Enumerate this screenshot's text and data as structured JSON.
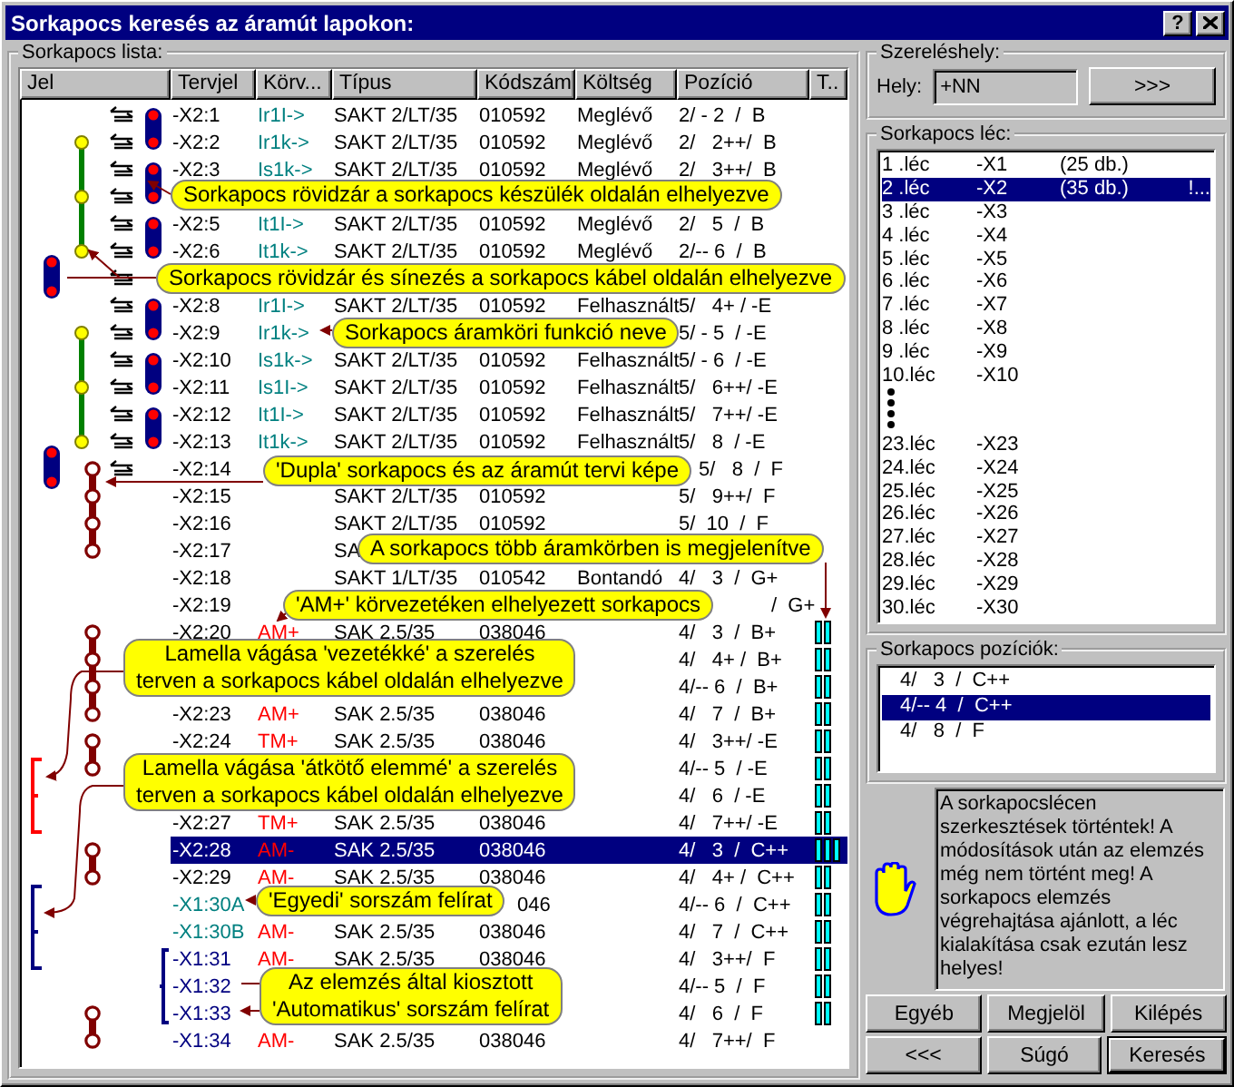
{
  "window": {
    "title": "Sorkapocs keresés az áramút lapokon:",
    "help_button": "?"
  },
  "terminal_list": {
    "title": "Sorkapocs lista:",
    "columns": [
      "Jel",
      "Tervjel",
      "Körv...",
      "Típus",
      "Kódszám",
      "Költség",
      "Pozíció",
      "T.."
    ],
    "rows": [
      {
        "kind": "plain",
        "tervjel": "-X2:1",
        "korv": "Ir1I->",
        "color": "#008080",
        "tipus": "SAKT 2/LT/35",
        "kodszam": "010592",
        "koltseg": "Meglévő",
        "pozicio": "2/ - 2  /  B",
        "selected": false
      },
      {
        "kind": "plain",
        "tervjel": "-X2:2",
        "korv": "Ir1k->",
        "color": "#008080",
        "tipus": "SAKT 2/LT/35",
        "kodszam": "010592",
        "koltseg": "Meglévő",
        "pozicio": "2/   2++/  B",
        "selected": false
      },
      {
        "kind": "plain",
        "tervjel": "-X2:3",
        "korv": "Is1k->",
        "color": "#008080",
        "tipus": "SAKT 2/LT/35",
        "kodszam": "010592",
        "koltseg": "Meglévő",
        "pozicio": "2/   3++/  B",
        "selected": false
      },
      {
        "kind": "hidden"
      },
      {
        "kind": "plain",
        "tervjel": "-X2:5",
        "korv": "It1I->",
        "color": "#008080",
        "tipus": "SAKT 2/LT/35",
        "kodszam": "010592",
        "koltseg": "Meglévő",
        "pozicio": "2/   5  /  B",
        "selected": false
      },
      {
        "kind": "plain",
        "tervjel": "-X2:6",
        "korv": "It1k->",
        "color": "#008080",
        "tipus": "SAKT 2/LT/35",
        "kodszam": "010592",
        "koltseg": "Meglévő",
        "pozicio": "2/-- 6  /  B",
        "selected": false
      },
      {
        "kind": "hidden"
      },
      {
        "kind": "plain",
        "tervjel": "-X2:8",
        "korv": "Ir1I->",
        "color": "#008080",
        "tipus": "SAKT 2/LT/35",
        "kodszam": "010592",
        "koltseg": "Felhasznált",
        "pozicio": "5/   4+ / -E",
        "selected": false
      },
      {
        "kind": "plain",
        "tervjel": "-X2:9",
        "korv": "Ir1k->",
        "color": "#008080",
        "pozicio": "5/ - 5  / -E",
        "selected": false
      },
      {
        "kind": "plain",
        "tervjel": "-X2:10",
        "korv": "Is1k->",
        "color": "#008080",
        "tipus": "SAKT 2/LT/35",
        "kodszam": "010592",
        "koltseg": "Felhasznált",
        "pozicio": "5/ - 6  / -E",
        "selected": false
      },
      {
        "kind": "plain",
        "tervjel": "-X2:11",
        "korv": "Is1I->",
        "color": "#008080",
        "tipus": "SAKT 2/LT/35",
        "kodszam": "010592",
        "koltseg": "Felhasznált",
        "pozicio": "5/   6++/ -E",
        "selected": false
      },
      {
        "kind": "plain",
        "tervjel": "-X2:12",
        "korv": "It1I->",
        "color": "#008080",
        "tipus": "SAKT 2/LT/35",
        "kodszam": "010592",
        "koltseg": "Felhasznált",
        "pozicio": "5/   7++/ -E",
        "selected": false
      },
      {
        "kind": "plain",
        "tervjel": "-X2:13",
        "korv": "It1k->",
        "color": "#008080",
        "tipus": "SAKT 2/LT/35",
        "kodszam": "010592",
        "koltseg": "Felhasznált",
        "pozicio": "5/   8  / -E",
        "selected": false
      },
      {
        "kind": "plain",
        "tervjel": "-X2:14",
        "pozicio": "5/   8  /  F",
        "selected": false
      },
      {
        "kind": "plain",
        "tervjel": "-X2:15",
        "tipus": "SAKT 2/LT/35",
        "kodszam": "010592",
        "pozicio": "5/   9++/  F",
        "selected": false
      },
      {
        "kind": "plain",
        "tervjel": "-X2:16",
        "tipus": "SAKT 2/LT/35",
        "kodszam": "010592",
        "pozicio": "5/  10  /  F",
        "selected": false
      },
      {
        "kind": "plain",
        "tervjel": "-X2:17",
        "tipus": "SA",
        "selected": false
      },
      {
        "kind": "plain",
        "tervjel": "-X2:18",
        "tipus": "SAKT 1/LT/35",
        "kodszam": "010542",
        "koltseg": "Bontandó",
        "pozicio": "4/   3  /  G+",
        "selected": false
      },
      {
        "kind": "plain",
        "tervjel": "-X2:19",
        "pozicio": "/  G+",
        "selected": false
      },
      {
        "kind": "plain",
        "tervjel": "-X2:20",
        "korv": "AM+",
        "color": "#ff0000",
        "tipus": "SAK 2.5/35",
        "kodszam": "038046",
        "pozicio": "4/   3  /  B+",
        "t_cell": {
          "kind": "double"
        },
        "selected": false
      },
      {
        "kind": "plain",
        "pozicio": "4/   4+ /  B+",
        "t_cell": {
          "kind": "double"
        },
        "selected": false
      },
      {
        "kind": "plain",
        "pozicio": "4/-- 6  /  B+",
        "t_cell": {
          "kind": "double"
        },
        "selected": false
      },
      {
        "kind": "plain",
        "tervjel": "-X2:23",
        "korv": "AM+",
        "color": "#ff0000",
        "tipus": "SAK 2.5/35",
        "kodszam": "038046",
        "pozicio": "4/   7  /  B+",
        "t_cell": {
          "kind": "double"
        },
        "selected": false
      },
      {
        "kind": "plain",
        "tervjel": "-X2:24",
        "korv": "TM+",
        "color": "#ff0000",
        "tipus": "SAK 2.5/35",
        "kodszam": "038046",
        "pozicio": "4/   3++/ -E",
        "t_cell": {
          "kind": "double"
        },
        "selected": false
      },
      {
        "kind": "plain",
        "pozicio": "4/-- 5  / -E",
        "t_cell": {
          "kind": "double"
        },
        "selected": false
      },
      {
        "kind": "plain",
        "pozicio": "4/   6  / -E",
        "t_cell": {
          "kind": "double"
        },
        "selected": false
      },
      {
        "kind": "plain",
        "tervjel": "-X2:27",
        "korv": "TM+",
        "color": "#ff0000",
        "tipus": "SAK 2.5/35",
        "kodszam": "038046",
        "pozicio": "4/   7++/ -E",
        "t_cell": {
          "kind": "double"
        },
        "selected": false
      },
      {
        "kind": "plain",
        "tervjel": "-X2:28",
        "korv": "AM-",
        "color": "#ff0000",
        "tipus": "SAK 2.5/35",
        "kodszam": "038046",
        "pozicio": "4/   3  /  C++",
        "t_cell": {
          "kind": "triple"
        },
        "selected": true
      },
      {
        "kind": "plain",
        "tervjel": "-X2:29",
        "korv": "AM-",
        "color": "#ff0000",
        "tipus": "SAK 2.5/35",
        "kodszam": "038046",
        "pozicio": "4/   4+ /  C++",
        "t_cell": {
          "kind": "double"
        },
        "selected": false
      },
      {
        "kind": "individual",
        "tervjel": "-X1:30A",
        "kodszam": "046",
        "pozicio": "4/-- 6  /  C++",
        "t_cell": {
          "kind": "double"
        },
        "selected": false
      },
      {
        "kind": "individual",
        "tervjel": "-X1:30B",
        "korv": "AM-",
        "color": "#ff0000",
        "tipus": "SAK 2.5/35",
        "kodszam": "038046",
        "pozicio": "4/   7  /  C++",
        "t_cell": {
          "kind": "double"
        },
        "selected": false
      },
      {
        "kind": "automatic",
        "tervjel": "-X1:31",
        "korv": "AM-",
        "color": "#ff0000",
        "tipus": "SAK 2.5/35",
        "kodszam": "038046",
        "pozicio": "4/   3++/  F",
        "t_cell": {
          "kind": "double"
        },
        "selected": false
      },
      {
        "kind": "automatic",
        "tervjel": "-X1:32",
        "pozicio": "4/-- 5  /  F",
        "t_cell": {
          "kind": "double"
        },
        "selected": false
      },
      {
        "kind": "automatic",
        "tervjel": "-X1:33",
        "pozicio": "4/   6  /  F",
        "t_cell": {
          "kind": "double"
        },
        "selected": false
      },
      {
        "kind": "automatic",
        "tervjel": "-X1:34",
        "korv": "AM-",
        "color": "#ff0000",
        "tipus": "SAK 2.5/35",
        "kodszam": "038046",
        "pozicio": "4/   7++/  F",
        "selected": false
      }
    ],
    "callouts": [
      {
        "lines": [
          "Sorkapocs rövidzár a sorkapocs készülék oldalán elhelyezve"
        ]
      },
      {
        "lines": [
          "Sorkapocs rövidzár és sínezés a sorkapocs kábel oldalán elhelyezve"
        ]
      },
      {
        "lines": [
          "Sorkapocs áramköri funkció neve"
        ]
      },
      {
        "lines": [
          "'Dupla' sorkapocs és az áramút tervi képe"
        ]
      },
      {
        "lines": [
          "A sorkapocs több áramkörben is megjelenítve"
        ]
      },
      {
        "lines": [
          "'AM+' körvezetéken elhelyezett sorkapocs"
        ]
      },
      {
        "lines": [
          "Lamella vágása 'vezetékké' a szerelés",
          "terven a sorkapocs kábel oldalán elhelyezve"
        ]
      },
      {
        "lines": [
          "Lamella vágása 'átkötő elemmé' a szerelés",
          "terven a sorkapocs kábel oldalán elhelyezve"
        ]
      },
      {
        "lines": [
          "'Egyedi' sorszám felírat"
        ]
      },
      {
        "lines": [
          "Az elemzés által kiosztott",
          "'Automatikus' sorszám felírat"
        ]
      }
    ]
  },
  "mounting_location": {
    "title": "Szereléshely:",
    "label": "Hely:",
    "value": "+NN",
    "button": ">>>"
  },
  "terminal_strips": {
    "title": "Sorkapocs léc:",
    "items": [
      {
        "kind": "strip",
        "label": "1 .léc",
        "code": "-X1",
        "count": "(25 db.)",
        "selected": false
      },
      {
        "kind": "strip",
        "label": "2 .léc",
        "code": "-X2",
        "count": "(35 db.)",
        "note": "!...",
        "selected": true
      },
      {
        "kind": "strip",
        "label": "3 .léc",
        "code": "-X3",
        "selected": false
      },
      {
        "kind": "strip",
        "label": "4 .léc",
        "code": "-X4",
        "selected": false
      },
      {
        "kind": "strip",
        "label": "5 .léc",
        "code": "-X5",
        "selected": false
      },
      {
        "kind": "strip",
        "label": "6 .léc",
        "code": "-X6",
        "selected": false
      },
      {
        "kind": "strip",
        "label": "7 .léc",
        "code": "-X7",
        "selected": false
      },
      {
        "kind": "strip",
        "label": "8 .léc",
        "code": "-X8",
        "selected": false
      },
      {
        "kind": "strip",
        "label": "9 .léc",
        "code": "-X9",
        "selected": false
      },
      {
        "kind": "strip",
        "label": "10.léc",
        "code": "-X10",
        "selected": false
      },
      {
        "kind": "gap"
      },
      {
        "kind": "strip",
        "label": "23.léc",
        "code": "-X23",
        "selected": false
      },
      {
        "kind": "strip",
        "label": "24.léc",
        "code": "-X24",
        "selected": false
      },
      {
        "kind": "strip",
        "label": "25.léc",
        "code": "-X25",
        "selected": false
      },
      {
        "kind": "strip",
        "label": "26.léc",
        "code": "-X26",
        "selected": false
      },
      {
        "kind": "strip",
        "label": "27.léc",
        "code": "-X27",
        "selected": false
      },
      {
        "kind": "strip",
        "label": "28.léc",
        "code": "-X28",
        "selected": false
      },
      {
        "kind": "strip",
        "label": "29.léc",
        "code": "-X29",
        "selected": false
      },
      {
        "kind": "strip",
        "label": "30.léc",
        "code": "-X30",
        "selected": false
      }
    ]
  },
  "positions": {
    "title": "Sorkapocs pozíciók:",
    "items": [
      {
        "text": "4/   3  /  C++",
        "selected": false
      },
      {
        "text": "4/-- 4  /  C++",
        "selected": true
      },
      {
        "text": "4/   8  /  F",
        "selected": false
      }
    ]
  },
  "message": "A sorkapocslécen szerkesztések történtek! A módosítások után az elemzés még nem történt meg! A sorkapocs elemzés végrehajtása ajánlott, a léc kialakítása csak ezután lesz helyes!",
  "buttons": [
    {
      "label": "Egyéb",
      "default": false
    },
    {
      "label": "Megjelöl",
      "default": false
    },
    {
      "label": "Kilépés",
      "default": false
    },
    {
      "label": "<<<",
      "default": false
    },
    {
      "label": "Súgó",
      "default": false
    },
    {
      "label": "Keresés",
      "default": true
    }
  ]
}
